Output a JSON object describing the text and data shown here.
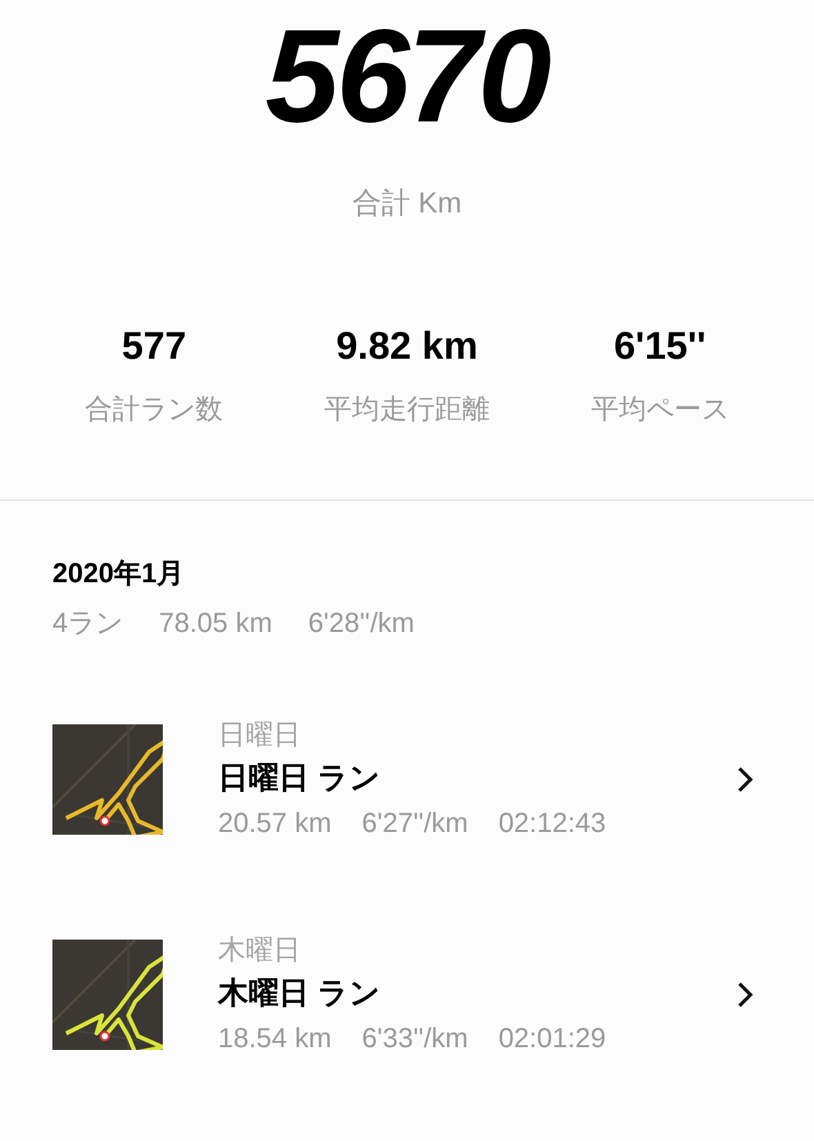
{
  "total": {
    "value": "5670",
    "label": "合計 Km"
  },
  "stats": [
    {
      "value": "577",
      "label": "合計ラン数"
    },
    {
      "value": "9.82 km",
      "label": "平均走行距離"
    },
    {
      "value": "6'15''",
      "label": "平均ペース"
    }
  ],
  "month": {
    "title": "2020年1月",
    "summary": [
      "4ラン",
      "78.05 km",
      "6'28''/km"
    ]
  },
  "runs": [
    {
      "kind": "picture",
      "day": "日曜日",
      "title": "日曜日 ラン",
      "details": [
        "20.57 km",
        "6'27''/km",
        "02:12:43"
      ]
    },
    {
      "kind": "picture",
      "day": "木曜日",
      "title": "木曜日 ラン",
      "details": [
        "18.54 km",
        "6'33''/km",
        "02:01:29"
      ]
    }
  ]
}
